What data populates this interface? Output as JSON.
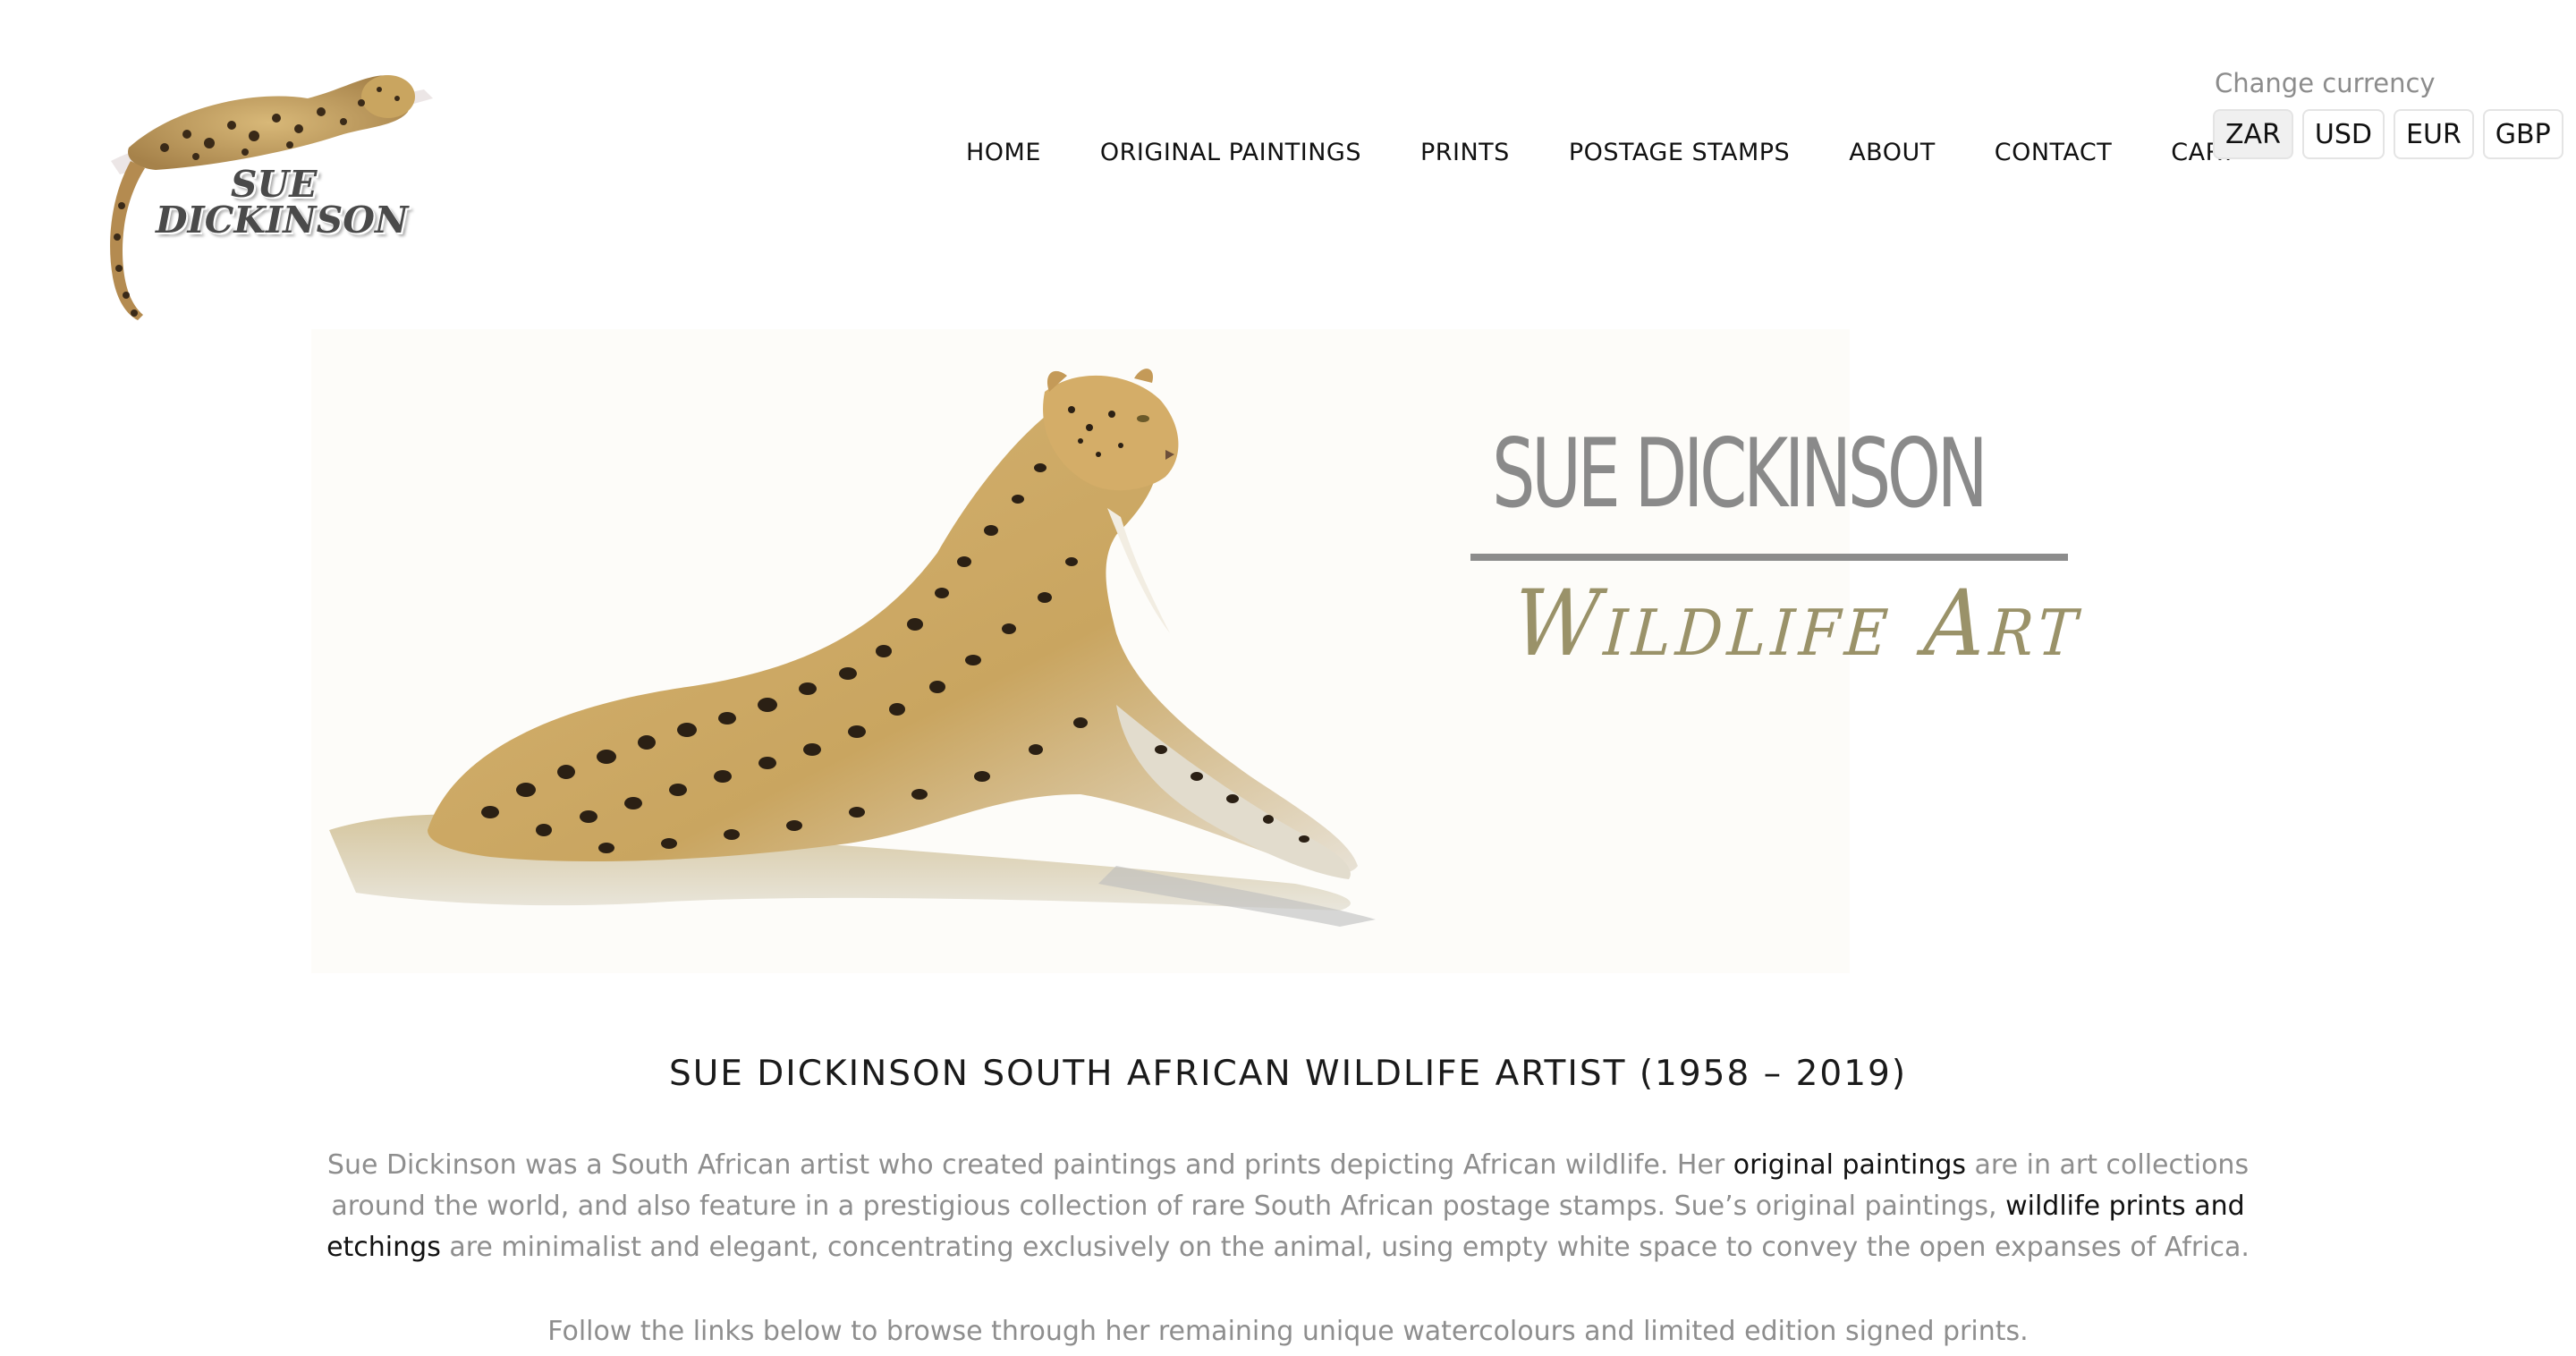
{
  "header": {
    "logo_line1": "SUE",
    "logo_line2": "DICKINSON"
  },
  "nav": {
    "items": [
      {
        "label": "HOME"
      },
      {
        "label": "ORIGINAL PAINTINGS"
      },
      {
        "label": "PRINTS"
      },
      {
        "label": "POSTAGE STAMPS"
      },
      {
        "label": "ABOUT"
      },
      {
        "label": "CONTACT"
      },
      {
        "label": "CART"
      }
    ]
  },
  "currency": {
    "label": "Change currency",
    "options": [
      "ZAR",
      "USD",
      "EUR",
      "GBP"
    ],
    "selected": "ZAR"
  },
  "hero": {
    "title": "SUE DICKINSON",
    "subtitle": "Wildlife Art"
  },
  "content": {
    "heading": "SUE DICKINSON SOUTH AFRICAN WILDLIFE ARTIST (1958 – 2019)",
    "intro_part1": "Sue Dickinson was a South African artist who created paintings and prints depicting African wildlife.  Her ",
    "intro_link1": "original paintings",
    "intro_part2": " are in art collections around the world, and also feature in a prestigious collection of rare South African postage stamps.  Sue’s original paintings, ",
    "intro_link2": "wildlife prints and etchings",
    "intro_part3": " are minimalist and elegant, concentrating exclusively on the animal, using empty white space to convey the open expanses of Africa.",
    "follow": "Follow the links below to browse through her remaining unique watercolours and limited edition signed prints."
  },
  "colors": {
    "text_gray": "#8e8e8e",
    "link": "#111111",
    "hero_title": "#8a8a8a",
    "hero_subtitle": "#9a9269",
    "leopard_base": "#c9a560"
  }
}
